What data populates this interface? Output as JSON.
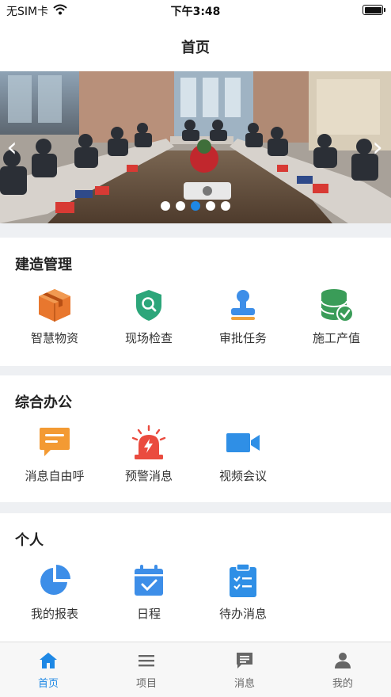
{
  "status_bar": {
    "carrier": "无SIM卡",
    "time": "下午3:48"
  },
  "nav": {
    "title": "首页"
  },
  "banner": {
    "prev_glyph": "‹",
    "next_glyph": "›",
    "slide_count": 5,
    "active_slide": 3
  },
  "sections": {
    "construction": {
      "title": "建造管理",
      "items": [
        {
          "label": "智慧物资",
          "icon": "box-icon",
          "color": "#e8772e"
        },
        {
          "label": "现场检查",
          "icon": "shield-search-icon",
          "color": "#2ca67a"
        },
        {
          "label": "审批任务",
          "icon": "stamp-icon",
          "color": "#3d8ee8"
        },
        {
          "label": "施工产值",
          "icon": "database-check-icon",
          "color": "#3a9c58"
        }
      ]
    },
    "office": {
      "title": "综合办公",
      "items": [
        {
          "label": "消息自由呼",
          "icon": "message-icon",
          "color": "#f39a33"
        },
        {
          "label": "预警消息",
          "icon": "alarm-icon",
          "color": "#ea4b3f"
        },
        {
          "label": "视频会议",
          "icon": "video-camera-icon",
          "color": "#2f8fe6"
        }
      ]
    },
    "personal": {
      "title": "个人",
      "items": [
        {
          "label": "我的报表",
          "icon": "pie-chart-icon",
          "color": "#3d8ee8"
        },
        {
          "label": "日程",
          "icon": "calendar-icon",
          "color": "#3d8ee8"
        },
        {
          "label": "待办消息",
          "icon": "clipboard-icon",
          "color": "#2f8fe6"
        }
      ]
    }
  },
  "tab_bar": {
    "tabs": [
      {
        "label": "首页",
        "icon": "home-icon",
        "active": true
      },
      {
        "label": "项目",
        "icon": "list-icon",
        "active": false
      },
      {
        "label": "消息",
        "icon": "chat-icon",
        "active": false
      },
      {
        "label": "我的",
        "icon": "person-icon",
        "active": false
      }
    ],
    "active_color": "#1e88e5",
    "inactive_color": "#666666"
  }
}
